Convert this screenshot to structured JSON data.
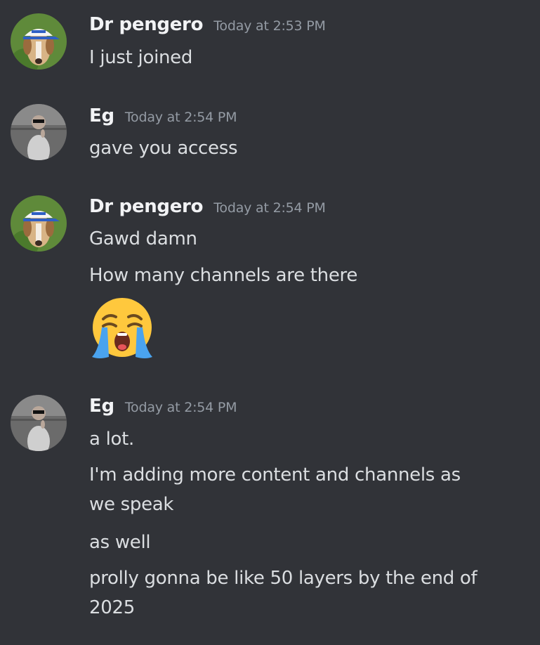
{
  "messages": [
    {
      "author": "Dr pengero",
      "timestamp": "Today at 2:53 PM",
      "avatar_icon": "dog-with-cap-avatar",
      "lines": [
        "I just joined"
      ]
    },
    {
      "author": "Eg",
      "timestamp": "Today at 2:54 PM",
      "avatar_icon": "child-photo-avatar",
      "lines": [
        "gave you access"
      ]
    },
    {
      "author": "Dr pengero",
      "timestamp": "Today at 2:54 PM",
      "avatar_icon": "dog-with-cap-avatar",
      "lines": [
        "Gawd damn",
        "How many channels are there"
      ],
      "emoji": "loudly-crying-face-emoji"
    },
    {
      "author": "Eg",
      "timestamp": "Today at 2:54 PM",
      "avatar_icon": "child-photo-avatar",
      "lines": [
        "a lot.",
        "I'm adding more content and channels as we speak",
        "as well",
        "prolly gonna be like 50 layers by the end of 2025"
      ]
    }
  ],
  "colors": {
    "background": "#313338",
    "username": "#f2f3f5",
    "timestamp": "#949ba4",
    "text": "#dbdee1"
  }
}
